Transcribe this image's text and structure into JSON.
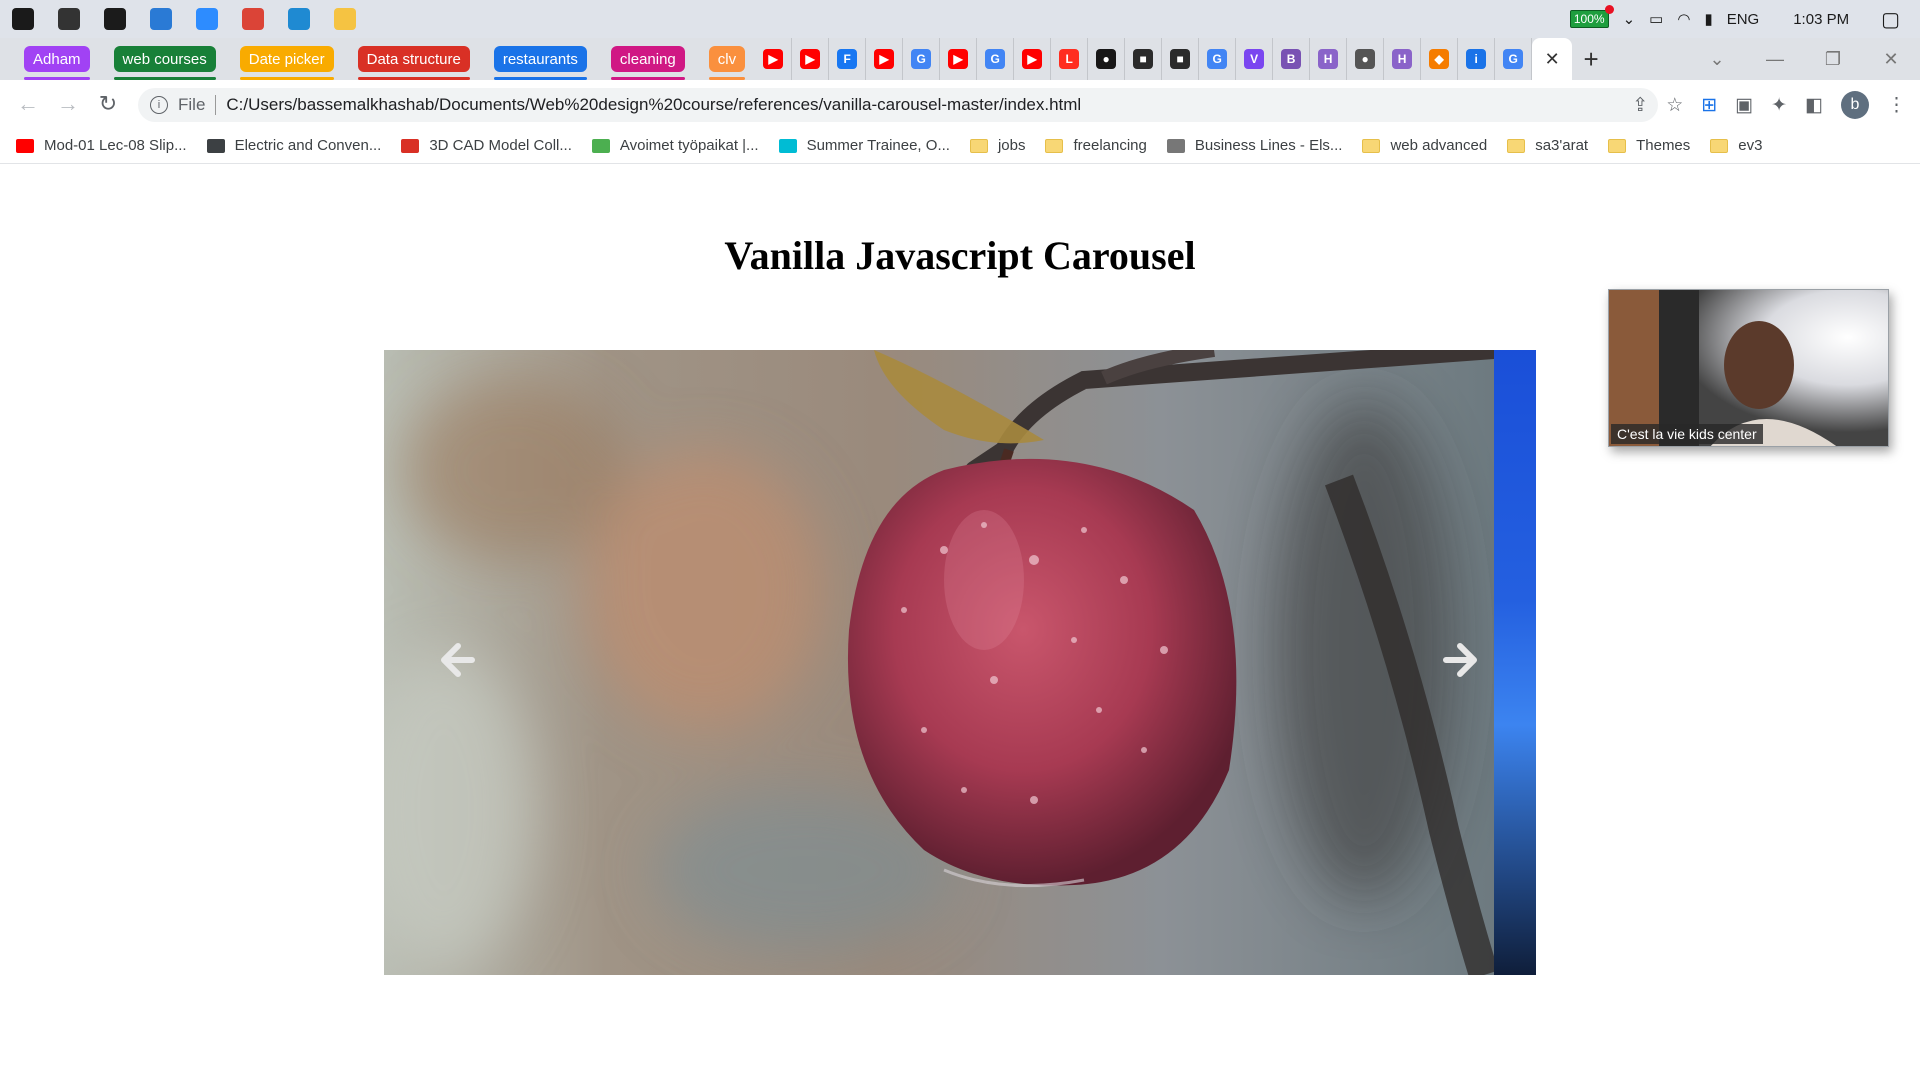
{
  "taskbar": {
    "apps": [
      {
        "name": "windows-start-icon",
        "color": "#1a1a1a"
      },
      {
        "name": "app-icon-1",
        "color": "#333333"
      },
      {
        "name": "app-icon-2",
        "color": "#1b1b1b"
      },
      {
        "name": "snipping-tool-icon",
        "color": "#2a7ad5"
      },
      {
        "name": "zoom-icon",
        "color": "#2d8cff"
      },
      {
        "name": "chrome-icon",
        "color": "#db4437"
      },
      {
        "name": "vscode-icon",
        "color": "#1f8ad2"
      },
      {
        "name": "file-explorer-icon",
        "color": "#f5c342"
      }
    ],
    "battery": "100%",
    "language": "ENG",
    "time": "1:03 PM"
  },
  "tab_groups": [
    {
      "label": "Adham",
      "color": "#a142f4"
    },
    {
      "label": "web courses",
      "color": "#188038"
    },
    {
      "label": "Date picker",
      "color": "#f9ab00"
    },
    {
      "label": "Data structure",
      "color": "#d93025"
    },
    {
      "label": "restaurants",
      "color": "#1a73e8"
    },
    {
      "label": "cleaning",
      "color": "#d01884"
    },
    {
      "label": "clv",
      "color": "#fa903e"
    }
  ],
  "pinned_tabs": [
    {
      "icon": "youtube-icon",
      "glyph": "▶",
      "color": "#ff0000"
    },
    {
      "icon": "youtube-icon",
      "glyph": "▶",
      "color": "#ff0000"
    },
    {
      "icon": "f-app-icon",
      "glyph": "F",
      "color": "#1877f2"
    },
    {
      "icon": "youtube-icon",
      "glyph": "▶",
      "color": "#ff0000"
    },
    {
      "icon": "google-icon",
      "glyph": "G",
      "color": "#4285f4"
    },
    {
      "icon": "youtube-icon",
      "glyph": "▶",
      "color": "#ff0000"
    },
    {
      "icon": "google-icon",
      "glyph": "G",
      "color": "#4285f4"
    },
    {
      "icon": "youtube-icon",
      "glyph": "▶",
      "color": "#ff0000"
    },
    {
      "icon": "laravel-icon",
      "glyph": "L",
      "color": "#ff2d20"
    },
    {
      "icon": "github-icon",
      "glyph": "●",
      "color": "#181717"
    },
    {
      "icon": "app-dark-icon",
      "glyph": "■",
      "color": "#2b2b2b"
    },
    {
      "icon": "app-dark-icon",
      "glyph": "■",
      "color": "#2b2b2b"
    },
    {
      "icon": "google-icon",
      "glyph": "G",
      "color": "#4285f4"
    },
    {
      "icon": "vuetify-icon",
      "glyph": "V",
      "color": "#7a46f0"
    },
    {
      "icon": "bootstrap-icon",
      "glyph": "B",
      "color": "#7952b3"
    },
    {
      "icon": "h-app-icon",
      "glyph": "H",
      "color": "#8a63c9"
    },
    {
      "icon": "globe-icon",
      "glyph": "●",
      "color": "#555555"
    },
    {
      "icon": "h-app-icon",
      "glyph": "H",
      "color": "#8a63c9"
    },
    {
      "icon": "cube-icon",
      "glyph": "◆",
      "color": "#f57c00"
    },
    {
      "icon": "info-app-icon",
      "glyph": "i",
      "color": "#1a73e8"
    },
    {
      "icon": "google-icon",
      "glyph": "G",
      "color": "#4285f4"
    }
  ],
  "address_bar": {
    "scheme": "File",
    "url": "C:/Users/bassemalkhashab/Documents/Web%20design%20course/references/vanilla-carousel-master/index.html"
  },
  "profile_initial": "b",
  "bookmarks": [
    {
      "label": "Mod-01 Lec-08 Slip...",
      "icon": "youtube-icon",
      "color": "#ff0000"
    },
    {
      "label": "Electric and Conven...",
      "icon": "site-icon",
      "color": "#3c4043"
    },
    {
      "label": "3D CAD Model Coll...",
      "icon": "gc-icon",
      "color": "#d93025"
    },
    {
      "label": "Avoimet työpaikat |...",
      "icon": "site-icon",
      "color": "#4caf50"
    },
    {
      "label": "Summer Trainee, O...",
      "icon": "heart-icon",
      "color": "#00bcd4"
    },
    {
      "label": "jobs",
      "icon": "folder-icon",
      "folder": true
    },
    {
      "label": "freelancing",
      "icon": "folder-icon",
      "folder": true
    },
    {
      "label": "Business Lines - Els...",
      "icon": "site-icon",
      "color": "#777777"
    },
    {
      "label": "web advanced",
      "icon": "folder-icon",
      "folder": true
    },
    {
      "label": "sa3'arat",
      "icon": "folder-icon",
      "folder": true
    },
    {
      "label": "Themes",
      "icon": "folder-icon",
      "folder": true
    },
    {
      "label": "ev3",
      "icon": "folder-icon",
      "folder": true
    }
  ],
  "page": {
    "title": "Vanilla Javascript Carousel"
  },
  "video_overlay": {
    "caption": "C'est la vie kids center"
  }
}
